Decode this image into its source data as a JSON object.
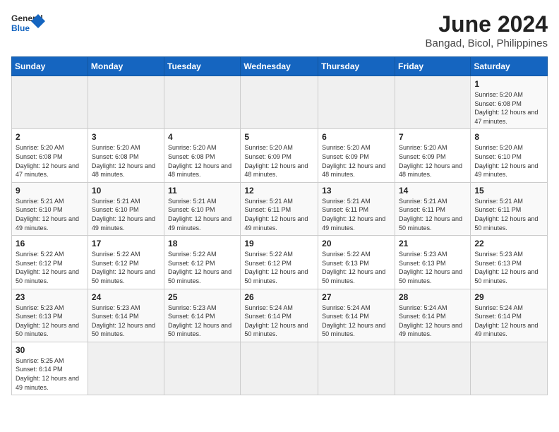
{
  "header": {
    "logo_general": "General",
    "logo_blue": "Blue",
    "title": "June 2024",
    "subtitle": "Bangad, Bicol, Philippines"
  },
  "weekdays": [
    "Sunday",
    "Monday",
    "Tuesday",
    "Wednesday",
    "Thursday",
    "Friday",
    "Saturday"
  ],
  "weeks": [
    [
      {
        "day": "",
        "info": ""
      },
      {
        "day": "",
        "info": ""
      },
      {
        "day": "",
        "info": ""
      },
      {
        "day": "",
        "info": ""
      },
      {
        "day": "",
        "info": ""
      },
      {
        "day": "",
        "info": ""
      },
      {
        "day": "1",
        "info": "Sunrise: 5:20 AM\nSunset: 6:08 PM\nDaylight: 12 hours and 47 minutes."
      }
    ],
    [
      {
        "day": "2",
        "info": "Sunrise: 5:20 AM\nSunset: 6:08 PM\nDaylight: 12 hours and 47 minutes."
      },
      {
        "day": "3",
        "info": "Sunrise: 5:20 AM\nSunset: 6:08 PM\nDaylight: 12 hours and 48 minutes."
      },
      {
        "day": "4",
        "info": "Sunrise: 5:20 AM\nSunset: 6:08 PM\nDaylight: 12 hours and 48 minutes."
      },
      {
        "day": "5",
        "info": "Sunrise: 5:20 AM\nSunset: 6:09 PM\nDaylight: 12 hours and 48 minutes."
      },
      {
        "day": "6",
        "info": "Sunrise: 5:20 AM\nSunset: 6:09 PM\nDaylight: 12 hours and 48 minutes."
      },
      {
        "day": "7",
        "info": "Sunrise: 5:20 AM\nSunset: 6:09 PM\nDaylight: 12 hours and 48 minutes."
      },
      {
        "day": "8",
        "info": "Sunrise: 5:20 AM\nSunset: 6:10 PM\nDaylight: 12 hours and 49 minutes."
      }
    ],
    [
      {
        "day": "9",
        "info": "Sunrise: 5:21 AM\nSunset: 6:10 PM\nDaylight: 12 hours and 49 minutes."
      },
      {
        "day": "10",
        "info": "Sunrise: 5:21 AM\nSunset: 6:10 PM\nDaylight: 12 hours and 49 minutes."
      },
      {
        "day": "11",
        "info": "Sunrise: 5:21 AM\nSunset: 6:10 PM\nDaylight: 12 hours and 49 minutes."
      },
      {
        "day": "12",
        "info": "Sunrise: 5:21 AM\nSunset: 6:11 PM\nDaylight: 12 hours and 49 minutes."
      },
      {
        "day": "13",
        "info": "Sunrise: 5:21 AM\nSunset: 6:11 PM\nDaylight: 12 hours and 49 minutes."
      },
      {
        "day": "14",
        "info": "Sunrise: 5:21 AM\nSunset: 6:11 PM\nDaylight: 12 hours and 50 minutes."
      },
      {
        "day": "15",
        "info": "Sunrise: 5:21 AM\nSunset: 6:11 PM\nDaylight: 12 hours and 50 minutes."
      }
    ],
    [
      {
        "day": "16",
        "info": "Sunrise: 5:22 AM\nSunset: 6:12 PM\nDaylight: 12 hours and 50 minutes."
      },
      {
        "day": "17",
        "info": "Sunrise: 5:22 AM\nSunset: 6:12 PM\nDaylight: 12 hours and 50 minutes."
      },
      {
        "day": "18",
        "info": "Sunrise: 5:22 AM\nSunset: 6:12 PM\nDaylight: 12 hours and 50 minutes."
      },
      {
        "day": "19",
        "info": "Sunrise: 5:22 AM\nSunset: 6:12 PM\nDaylight: 12 hours and 50 minutes."
      },
      {
        "day": "20",
        "info": "Sunrise: 5:22 AM\nSunset: 6:13 PM\nDaylight: 12 hours and 50 minutes."
      },
      {
        "day": "21",
        "info": "Sunrise: 5:23 AM\nSunset: 6:13 PM\nDaylight: 12 hours and 50 minutes."
      },
      {
        "day": "22",
        "info": "Sunrise: 5:23 AM\nSunset: 6:13 PM\nDaylight: 12 hours and 50 minutes."
      }
    ],
    [
      {
        "day": "23",
        "info": "Sunrise: 5:23 AM\nSunset: 6:13 PM\nDaylight: 12 hours and 50 minutes."
      },
      {
        "day": "24",
        "info": "Sunrise: 5:23 AM\nSunset: 6:14 PM\nDaylight: 12 hours and 50 minutes."
      },
      {
        "day": "25",
        "info": "Sunrise: 5:23 AM\nSunset: 6:14 PM\nDaylight: 12 hours and 50 minutes."
      },
      {
        "day": "26",
        "info": "Sunrise: 5:24 AM\nSunset: 6:14 PM\nDaylight: 12 hours and 50 minutes."
      },
      {
        "day": "27",
        "info": "Sunrise: 5:24 AM\nSunset: 6:14 PM\nDaylight: 12 hours and 50 minutes."
      },
      {
        "day": "28",
        "info": "Sunrise: 5:24 AM\nSunset: 6:14 PM\nDaylight: 12 hours and 49 minutes."
      },
      {
        "day": "29",
        "info": "Sunrise: 5:24 AM\nSunset: 6:14 PM\nDaylight: 12 hours and 49 minutes."
      }
    ],
    [
      {
        "day": "30",
        "info": "Sunrise: 5:25 AM\nSunset: 6:14 PM\nDaylight: 12 hours and 49 minutes."
      },
      {
        "day": "",
        "info": ""
      },
      {
        "day": "",
        "info": ""
      },
      {
        "day": "",
        "info": ""
      },
      {
        "day": "",
        "info": ""
      },
      {
        "day": "",
        "info": ""
      },
      {
        "day": "",
        "info": ""
      }
    ]
  ]
}
